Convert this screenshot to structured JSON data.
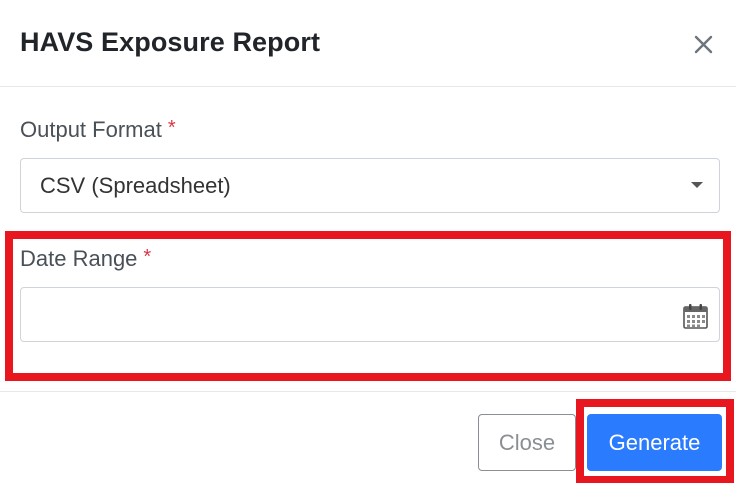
{
  "dialog": {
    "title": "HAVS Exposure Report",
    "close_icon": "close-icon"
  },
  "form": {
    "output_format": {
      "label": "Output Format",
      "required_marker": "*",
      "selected_value": "CSV (Spreadsheet)",
      "caret_icon": "chevron-down-icon"
    },
    "date_range": {
      "label": "Date Range",
      "required_marker": "*",
      "value": "",
      "placeholder": "",
      "icon": "calendar-icon"
    }
  },
  "footer": {
    "close_label": "Close",
    "generate_label": "Generate"
  },
  "colors": {
    "primary": "#2b7bff",
    "required": "#dc3545",
    "highlight": "#e8161f",
    "text": "#212529",
    "muted": "#8a8f94"
  }
}
